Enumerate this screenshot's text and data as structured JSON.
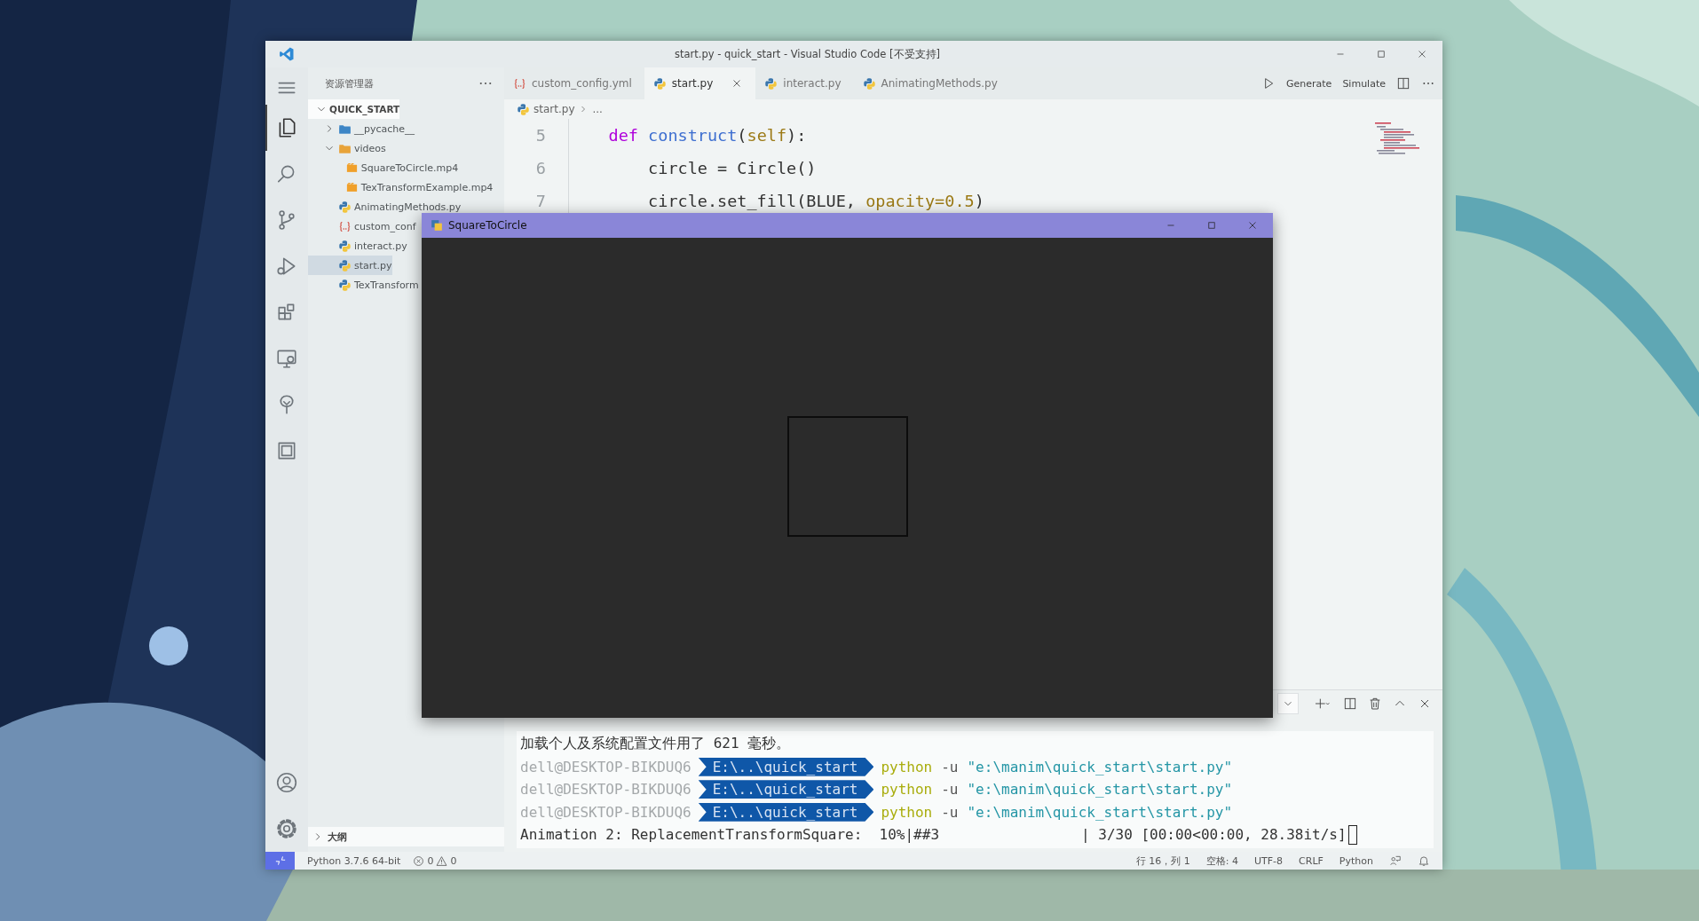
{
  "window": {
    "title": "start.py - quick_start - Visual Studio Code [不受支持]"
  },
  "activity_bar": {
    "items": [
      {
        "kind": "menu",
        "selected": false
      },
      {
        "kind": "explorer",
        "selected": true
      },
      {
        "kind": "search",
        "selected": false
      },
      {
        "kind": "scm",
        "selected": false
      },
      {
        "kind": "run",
        "selected": false
      },
      {
        "kind": "extensions",
        "selected": false
      },
      {
        "kind": "remote",
        "selected": false
      },
      {
        "kind": "tree",
        "selected": false
      },
      {
        "kind": "frame",
        "selected": false
      }
    ],
    "bottom": [
      {
        "kind": "account"
      },
      {
        "kind": "settings"
      }
    ]
  },
  "sidebar": {
    "title": "资源管理器",
    "root": {
      "label": "QUICK_START",
      "expanded": true,
      "children": [
        {
          "label": "__pycache__",
          "kind": "folder",
          "color": "#3d86c6",
          "expanded": false,
          "selected": false
        },
        {
          "label": "videos",
          "kind": "folder",
          "color": "#e8a33a",
          "expanded": true,
          "selected": false,
          "children": [
            {
              "label": "SquareToCircle.mp4",
              "kind": "video",
              "selected": false
            },
            {
              "label": "TexTransformExample.mp4",
              "kind": "video",
              "selected": false
            }
          ]
        },
        {
          "label": "AnimatingMethods.py",
          "kind": "python",
          "selected": false
        },
        {
          "label": "custom_conf",
          "kind": "yaml",
          "selected": false
        },
        {
          "label": "interact.py",
          "kind": "python",
          "selected": false
        },
        {
          "label": "start.py",
          "kind": "python",
          "selected": true
        },
        {
          "label": "TexTransform",
          "kind": "python",
          "selected": false
        }
      ]
    },
    "outline": {
      "label": "大纲",
      "expanded": false
    }
  },
  "tabs": [
    {
      "label": "custom_config.yml",
      "kind": "yaml",
      "selected": false
    },
    {
      "label": "start.py",
      "kind": "python",
      "selected": true
    },
    {
      "label": "interact.py",
      "kind": "python",
      "selected": false
    },
    {
      "label": "AnimatingMethods.py",
      "kind": "python",
      "selected": false
    }
  ],
  "editor_actions": [
    {
      "kind": "run"
    },
    {
      "kind": "text",
      "label": "Generate"
    },
    {
      "kind": "text",
      "label": "Simulate"
    },
    {
      "kind": "split"
    },
    {
      "kind": "more"
    }
  ],
  "breadcrumb": {
    "file": "start.py",
    "rest": "..."
  },
  "editor": {
    "lines": [
      {
        "number": "5",
        "tokens": [
          {
            "kind": "keyword",
            "text": "    def "
          },
          {
            "kind": "function",
            "text": "construct"
          },
          {
            "kind": "plain",
            "text": "("
          },
          {
            "kind": "param",
            "text": "self"
          },
          {
            "kind": "plain",
            "text": "):"
          }
        ]
      },
      {
        "number": "6",
        "tokens": [
          {
            "kind": "plain",
            "text": "        circle = Circle()"
          }
        ]
      },
      {
        "number": "7",
        "tokens": [
          {
            "kind": "plain",
            "text": "        circle.set_fill(BLUE, "
          },
          {
            "kind": "param",
            "text": "opacity=0.5"
          },
          {
            "kind": "plain",
            "text": ")"
          }
        ]
      }
    ]
  },
  "panel": {
    "actions": [
      {
        "kind": "dropdown"
      },
      {
        "kind": "add"
      },
      {
        "kind": "split"
      },
      {
        "kind": "trash"
      },
      {
        "kind": "maximize"
      },
      {
        "kind": "close"
      }
    ],
    "terminal": {
      "lines": [
        {
          "kind": "text",
          "text": "加载个人及系统配置文件用了 621 毫秒。"
        },
        {
          "kind": "prompt",
          "user": "dell@DESKTOP-BIKDUQ6",
          "path": "E:\\..\\quick_start",
          "command": "python",
          "flag": "-u",
          "argument": "\"e:\\manim\\quick_start\\start.py\""
        },
        {
          "kind": "prompt",
          "user": "dell@DESKTOP-BIKDUQ6",
          "path": "E:\\..\\quick_start",
          "command": "python",
          "flag": "-u",
          "argument": "\"e:\\manim\\quick_start\\start.py\""
        },
        {
          "kind": "prompt",
          "user": "dell@DESKTOP-BIKDUQ6",
          "path": "E:\\..\\quick_start",
          "command": "python",
          "flag": "-u",
          "argument": "\"e:\\manim\\quick_start\\start.py\""
        },
        {
          "kind": "progress",
          "text": "Animation 2: ReplacementTransformSquare:  10%|##3",
          "stats": "| 3/30 [00:00<00:00, 28.38it/s]",
          "cursor": true
        }
      ]
    }
  },
  "status_bar": {
    "left": [
      {
        "kind": "remote"
      },
      {
        "kind": "text",
        "text": "Python 3.7.6 64-bit"
      },
      {
        "kind": "problems",
        "errors": "0",
        "warnings": "0"
      }
    ],
    "right": [
      {
        "kind": "text",
        "text": "行 16，列 1"
      },
      {
        "kind": "text",
        "text": "空格: 4"
      },
      {
        "kind": "text",
        "text": "UTF-8"
      },
      {
        "kind": "text",
        "text": "CRLF"
      },
      {
        "kind": "text",
        "text": "Python"
      },
      {
        "kind": "feedback"
      },
      {
        "kind": "bell"
      }
    ]
  },
  "preview_window": {
    "title": "SquareToCircle"
  }
}
